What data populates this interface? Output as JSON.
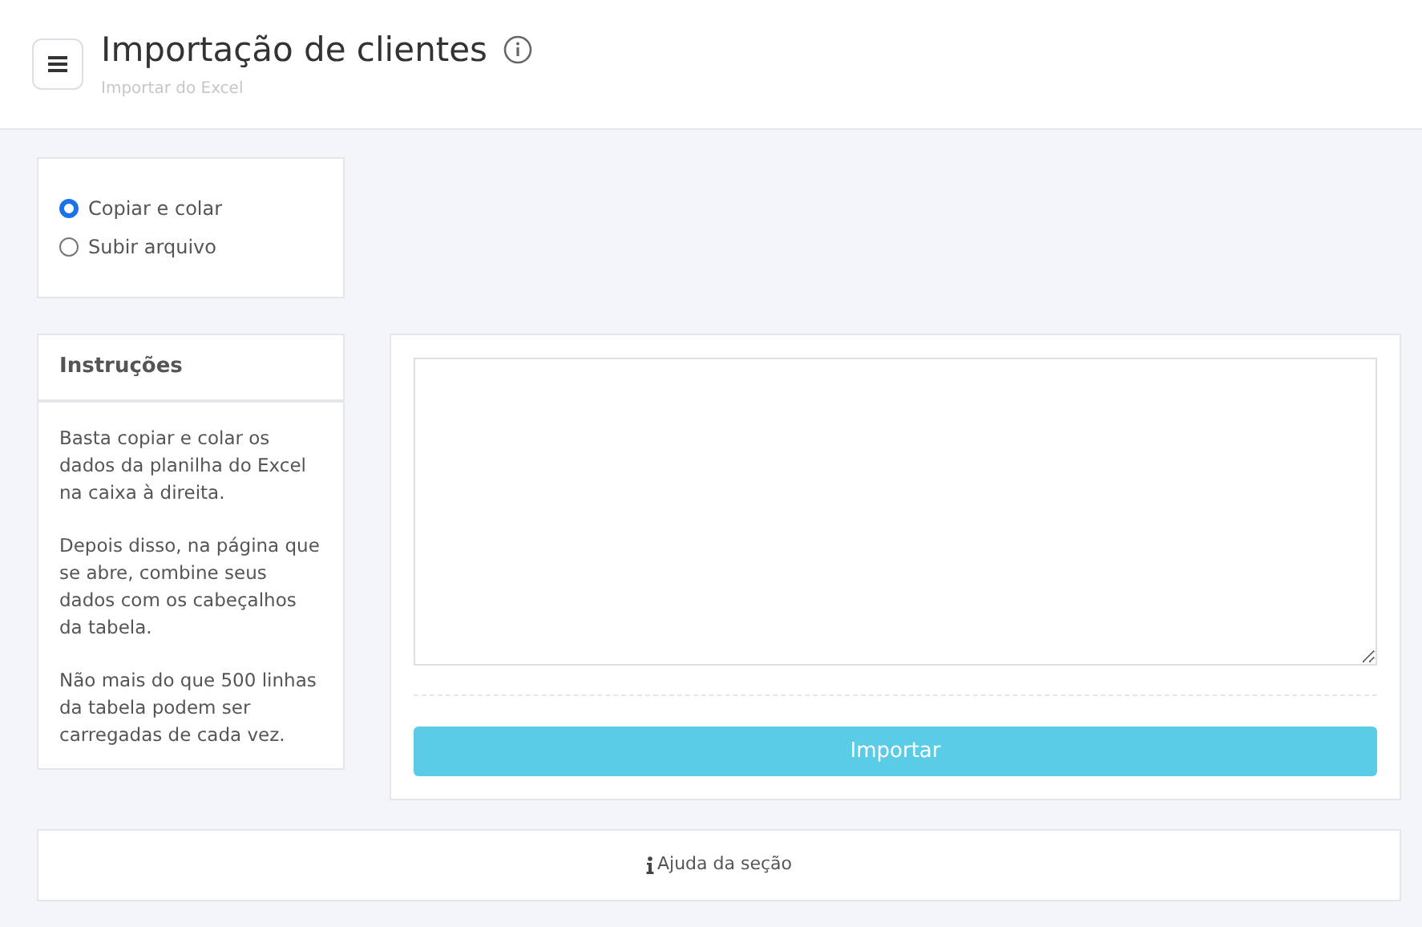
{
  "header": {
    "title": "Importação de clientes",
    "subtitle": "Importar do Excel"
  },
  "import_modes": [
    {
      "label": "Copiar e colar",
      "selected": true
    },
    {
      "label": "Subir arquivo",
      "selected": false
    }
  ],
  "instructions": {
    "title": "Instruções",
    "paragraphs": [
      "Basta copiar e colar os dados da planilha do Excel na caixa à direita.",
      "Depois disso, na página que se abre, combine seus dados com os cabeçalhos da tabela.",
      "Não mais do que 500 linhas da tabela podem ser carregadas de cada vez."
    ]
  },
  "import_button": "Importar",
  "help_link": "Ajuda da seção"
}
